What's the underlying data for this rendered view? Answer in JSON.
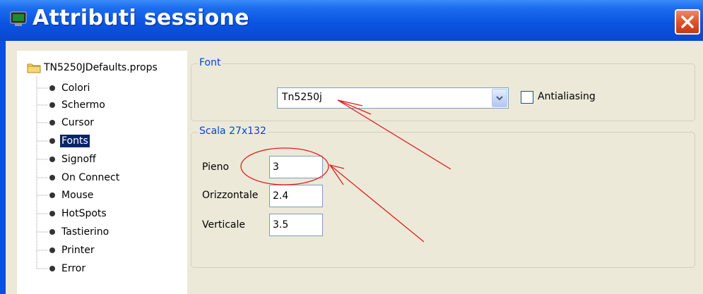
{
  "window": {
    "title": "Attributi sessione"
  },
  "tree": {
    "root": "TN5250JDefaults.props",
    "items": [
      {
        "label": "Colori",
        "selected": false
      },
      {
        "label": "Schermo",
        "selected": false
      },
      {
        "label": "Cursor",
        "selected": false
      },
      {
        "label": "Fonts",
        "selected": true
      },
      {
        "label": "Signoff",
        "selected": false
      },
      {
        "label": "On Connect",
        "selected": false
      },
      {
        "label": "Mouse",
        "selected": false
      },
      {
        "label": "HotSpots",
        "selected": false
      },
      {
        "label": "Tastierino",
        "selected": false
      },
      {
        "label": "Printer",
        "selected": false
      },
      {
        "label": "Error",
        "selected": false
      }
    ]
  },
  "font_group": {
    "title": "Font",
    "selected_font": "Tn5250j",
    "antialiasing_label": "Antialiasing",
    "antialiasing_checked": false
  },
  "scale_group": {
    "title": "Scala 27x132",
    "fields": [
      {
        "label": "Pieno",
        "value": "3"
      },
      {
        "label": "Orizzontale",
        "value": "2.4"
      },
      {
        "label": "Verticale",
        "value": "3.5"
      }
    ]
  },
  "colors": {
    "titlebar": "#0b55e2",
    "group_title": "#0046d5",
    "annotation": "#e02020",
    "selection": "#0a246a"
  },
  "icons": [
    "app-terminal-icon",
    "close-icon",
    "folder-icon",
    "dropdown-arrow-icon"
  ]
}
